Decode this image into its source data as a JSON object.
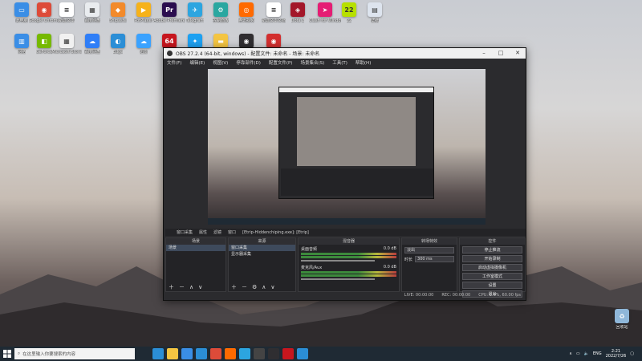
{
  "desktop": {
    "icons": [
      {
        "label": "此电脑",
        "color": "#3a8ee6",
        "glyph": "▭"
      },
      {
        "label": "Google Chrome",
        "color": "#dd4b39",
        "glyph": "◉"
      },
      {
        "label": "新建文本",
        "color": "#ffffff",
        "glyph": "≡"
      },
      {
        "label": "百度网盘",
        "color": "#e9ecef",
        "glyph": "▦"
      },
      {
        "label": "Snipaste",
        "color": "#f28a2b",
        "glyph": "◆"
      },
      {
        "label": "PotPlayer",
        "color": "#f6b21a",
        "glyph": "▶"
      },
      {
        "label": "Adobe Premiere",
        "color": "#2a0d4f",
        "glyph": "Pr"
      },
      {
        "label": "Telegram",
        "color": "#2ca5e0",
        "glyph": "✈"
      },
      {
        "label": "控制面板",
        "color": "#2aa7a0",
        "glyph": "⚙"
      },
      {
        "label": "腾讯视频",
        "color": "#ff6a00",
        "glyph": "◎"
      },
      {
        "label": "新建文本文档",
        "color": "#ffffff",
        "glyph": "≡"
      },
      {
        "label": "Dota 2",
        "color": "#a3172a",
        "glyph": "◈"
      },
      {
        "label": "Clash for Windows",
        "color": "#e51d74",
        "glyph": "➤"
      },
      {
        "label": "22",
        "color": "#b7e000",
        "glyph": "22"
      },
      {
        "label": "壁纸",
        "color": "#dde4ee",
        "glyph": "▤"
      },
      {
        "label": "网络",
        "color": "#3a8ee6",
        "glyph": "▥"
      },
      {
        "label": "GeForce",
        "color": "#76b900",
        "glyph": "◧"
      },
      {
        "label": "Microsoft Store",
        "color": "#f1f1f1",
        "glyph": "▦"
      },
      {
        "label": "百度网盘",
        "color": "#2f7ef7",
        "glyph": "☁"
      },
      {
        "label": "Edge",
        "color": "#2b8ed6",
        "glyph": "◐"
      },
      {
        "label": "迅雷",
        "color": "#3aa2ff",
        "glyph": "☁"
      },
      {
        "label": "64",
        "color": "#c7161e",
        "glyph": "64"
      },
      {
        "label": "Twitter",
        "color": "#1da1f2",
        "glyph": "✦"
      },
      {
        "label": "文件夹",
        "color": "#f4c542",
        "glyph": "▬"
      },
      {
        "label": "OBS Studio",
        "color": "#302e31",
        "glyph": "◉"
      },
      {
        "label": "网易云音乐",
        "color": "#d32f2f",
        "glyph": "◉"
      }
    ]
  },
  "obs": {
    "title": "OBS 27.2.4 (64-bit, windows) - 配置文件: 未命名 - 场景: 未命名",
    "menu": [
      "文件(F)",
      "编辑(E)",
      "视图(V)",
      "停靠部件(D)",
      "配置文件(P)",
      "场景集合(S)",
      "工具(T)",
      "帮助(H)"
    ],
    "scene_bar": [
      "窗口采集",
      "属性",
      "滤镜",
      "窗口",
      "[Etrip-Hiddenchiping.exe]: [Etrip]"
    ],
    "docks": {
      "scenes": {
        "title": "场景",
        "items": [
          "场景"
        ]
      },
      "sources": {
        "title": "来源",
        "items": [
          "窗口采集",
          "显示器采集"
        ]
      },
      "mixer": {
        "title": "混音器",
        "tracks": [
          {
            "name": "桌面音频",
            "db": "0.0 dB"
          },
          {
            "name": "麦克风/Aux",
            "db": "0.0 dB"
          }
        ]
      },
      "transitions": {
        "title": "转场特效",
        "type": "淡出",
        "duration_label": "时长",
        "duration": "300 ms"
      },
      "controls": {
        "title": "控件",
        "buttons": [
          "停止推流",
          "开始录制",
          "启动虚拟摄像机",
          "工作室模式",
          "设置",
          "退出"
        ]
      }
    },
    "status": {
      "live": "LIVE: 00:00:00",
      "rec": "REC: 00:00:00",
      "cpu": "CPU: 0.9%, 60.00 fps"
    }
  },
  "taskbar": {
    "search_placeholder": "在这里输入你要搜索的内容",
    "tray": {
      "lang": "ENG",
      "time": "2:21",
      "date": "2022/7/26"
    }
  },
  "recycle_bin": {
    "label": "回收站"
  }
}
